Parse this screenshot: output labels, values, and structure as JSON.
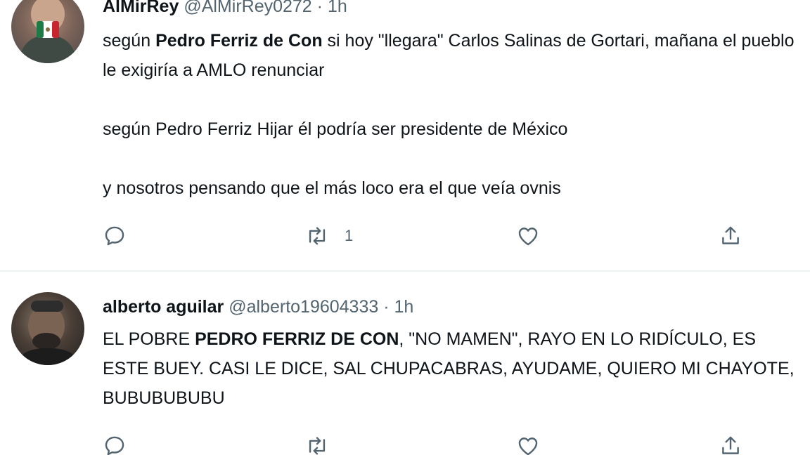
{
  "tweets": [
    {
      "display_name": "AlMirRey",
      "handle": "@AlMirRey0272",
      "dot": "·",
      "time": "1h",
      "paragraphs": [
        {
          "pre": "según ",
          "bold": "Pedro Ferriz de Con",
          "post": " si hoy \"llegara\" Carlos Salinas de Gortari, mañana el pueblo le exigiría a AMLO renunciar"
        },
        {
          "text": "según Pedro Ferriz Hijar él podría ser presidente de México"
        },
        {
          "text": "y nosotros pensando que el más loco era el que veía ovnis"
        }
      ],
      "retweet_count": "1"
    },
    {
      "display_name": "alberto aguilar",
      "handle": "@alberto19604333",
      "dot": "·",
      "time": "1h",
      "paragraphs": [
        {
          "pre": "EL POBRE ",
          "bold": "PEDRO FERRIZ DE CON",
          "post": ", \"NO MAMEN\", RAYO EN LO RIDÍCULO, ES ESTE BUEY. CASI LE DICE,  SAL CHUPACABRAS, AYUDAME, QUIERO MI CHAYOTE, BUBUBUBUBU"
        }
      ],
      "retweet_count": ""
    }
  ],
  "icons": {
    "reply": "reply-icon",
    "retweet": "retweet-icon",
    "like": "like-icon",
    "share": "share-icon"
  },
  "colors": {
    "text": "#0f1419",
    "muted": "#536471",
    "divider": "#eff3f4"
  }
}
